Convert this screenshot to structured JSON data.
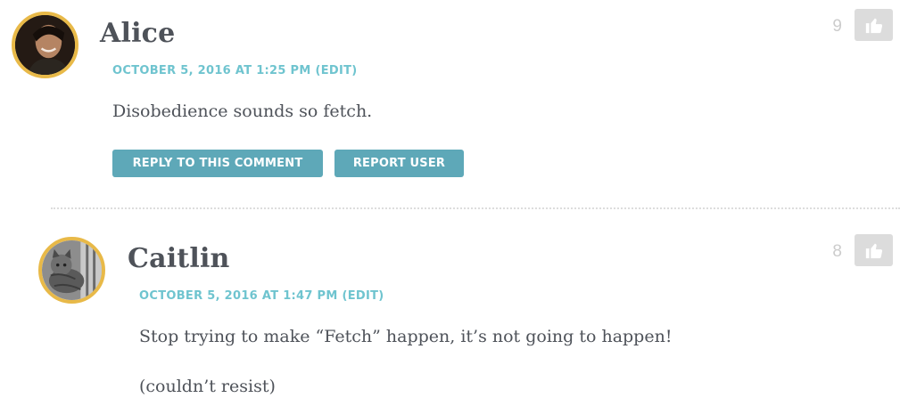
{
  "comments": [
    {
      "author": "Alice",
      "date": "OCTOBER 5, 2016 AT 1:25 PM",
      "edit_label": "(EDIT)",
      "text": [
        "Disobedience sounds so fetch."
      ],
      "votes": "9",
      "buttons": {
        "reply": "REPLY TO THIS COMMENT",
        "report": "REPORT USER"
      }
    },
    {
      "author": "Caitlin",
      "date": "OCTOBER 5, 2016 AT 1:47 PM",
      "edit_label": "(EDIT)",
      "text": [
        "Stop trying to make “Fetch” happen, it’s not going to happen!",
        "(couldn’t resist)"
      ],
      "votes": "8"
    }
  ],
  "colors": {
    "avatar_border": "#e8b948",
    "meta": "#6fc4cf",
    "button_bg": "#5ea8b8",
    "text": "#4e5259",
    "like_bg": "#dcdcdc"
  },
  "icons": {
    "like": "thumbs-up-icon"
  }
}
